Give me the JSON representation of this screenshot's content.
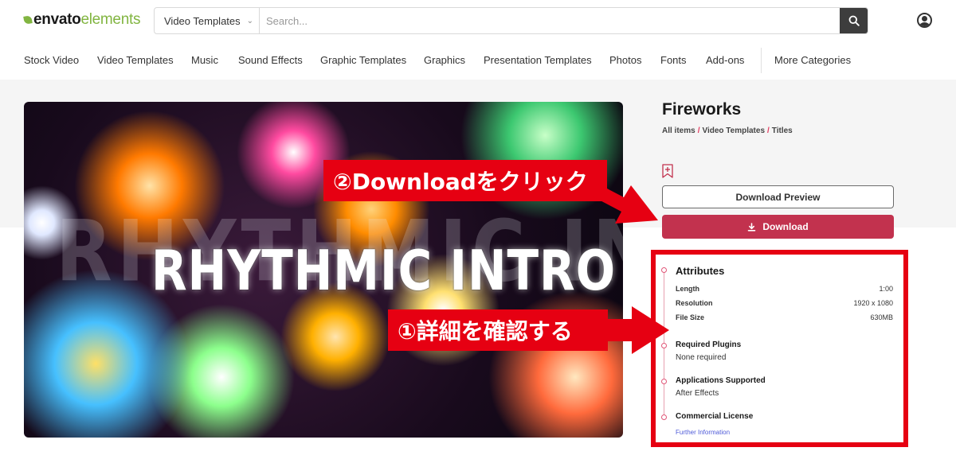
{
  "header": {
    "logo_part1": "envato",
    "logo_part2": "elements",
    "search_category": "Video Templates",
    "search_placeholder": "Search...",
    "search_icon": "search-icon",
    "account_icon": "user-icon"
  },
  "nav": {
    "items": [
      "Stock Video",
      "Video Templates",
      "Music",
      "Sound Effects",
      "Graphic Templates",
      "Graphics",
      "Presentation Templates",
      "Photos",
      "Fonts",
      "Add-ons",
      "More Categories"
    ]
  },
  "preview": {
    "ghost_text": "RHYTHMIC INTRO",
    "title_text": "RHYTHMIC INTRO"
  },
  "item": {
    "title": "Fireworks",
    "breadcrumb": [
      "All items",
      "Video Templates",
      "Titles"
    ],
    "bookmark_icon": "bookmark-add-icon",
    "preview_button": "Download Preview",
    "download_button": "Download",
    "download_icon": "download-icon"
  },
  "attributes": {
    "heading": "Attributes",
    "rows": [
      {
        "label": "Length",
        "value": "1:00"
      },
      {
        "label": "Resolution",
        "value": "1920 x 1080"
      },
      {
        "label": "File Size",
        "value": "630MB"
      }
    ],
    "plugins_label": "Required Plugins",
    "plugins_value": "None required",
    "apps_label": "Applications Supported",
    "apps_value": "After Effects",
    "license_label": "Commercial License",
    "license_link": "Further Information"
  },
  "annotations": {
    "callout_download": "②Downloadをクリック",
    "callout_details": "①詳細を確認する",
    "color": "#e60012"
  },
  "colors": {
    "brand_green": "#82b541",
    "download_red": "#c2324e",
    "breadcrumb_sep": "#e4375c",
    "link_blue": "#4e5ad8"
  }
}
